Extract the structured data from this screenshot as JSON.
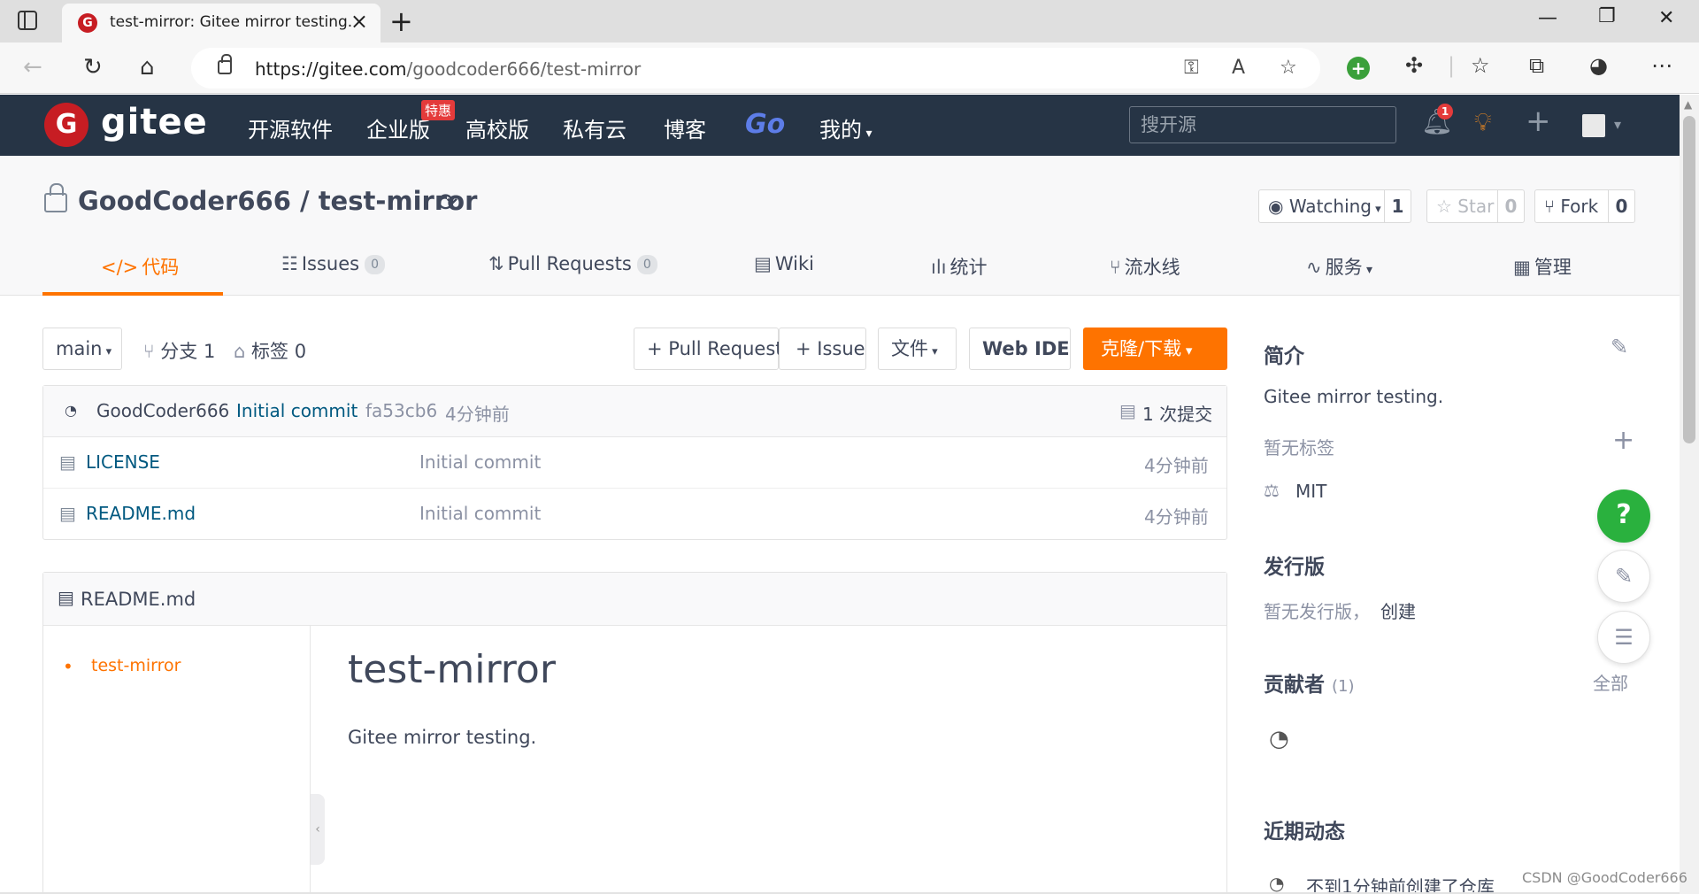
{
  "browser": {
    "tab_title": "test-mirror: Gitee mirror testing.",
    "url_host": "https://gitee.com",
    "url_path": "/goodcoder666/test-mirror"
  },
  "header": {
    "logo_text": "gitee",
    "nav": [
      "开源软件",
      "企业版",
      "高校版",
      "私有云",
      "博客",
      "Go",
      "我的"
    ],
    "hot_badge": "特惠",
    "search_placeholder": "搜开源",
    "notification_count": "1"
  },
  "repo": {
    "owner": "GoodCoder666",
    "separator": " / ",
    "name": "test-mirror",
    "watch_label": "Watching",
    "watch_count": "1",
    "star_label": "Star",
    "star_count": "0",
    "fork_label": "Fork",
    "fork_count": "0",
    "tabs": [
      {
        "label": "代码"
      },
      {
        "label": "Issues",
        "badge": "0"
      },
      {
        "label": "Pull Requests",
        "badge": "0"
      },
      {
        "label": "Wiki"
      },
      {
        "label": "统计"
      },
      {
        "label": "流水线"
      },
      {
        "label": "服务"
      },
      {
        "label": "管理"
      }
    ]
  },
  "toolbar": {
    "branch": "main",
    "branches": "分支 1",
    "tags": "标签 0",
    "pull_request": "+ Pull Request",
    "issue": "+ Issue",
    "file": "文件",
    "web_ide": "Web IDE",
    "clone": "克隆/下载"
  },
  "commit": {
    "author": "GoodCoder666",
    "message": "Initial commit",
    "hash": "fa53cb6",
    "time": "4分钟前",
    "count": "1 次提交"
  },
  "files": [
    {
      "name": "LICENSE",
      "message": "Initial commit",
      "time": "4分钟前"
    },
    {
      "name": "README.md",
      "message": "Initial commit",
      "time": "4分钟前"
    }
  ],
  "readme": {
    "filename": "README.md",
    "toc_item": "test-mirror",
    "title": "test-mirror",
    "body": "Gitee mirror testing."
  },
  "sidebar": {
    "intro_title": "简介",
    "description": "Gitee mirror testing.",
    "no_tags": "暂无标签",
    "license": "MIT",
    "release_title": "发行版",
    "no_release": "暂无发行版，",
    "create": "创建",
    "contributors_title": "贡献者",
    "contributors_count": "(1)",
    "all": "全部",
    "activity_title": "近期动态",
    "activity_text": "不到1分钟前创建了仓库"
  },
  "watermark": "CSDN @GoodCoder666",
  "colors": {
    "accent": "#fe7300",
    "header_bg": "#263445",
    "link": "#005980",
    "brand": "#c71d23"
  }
}
